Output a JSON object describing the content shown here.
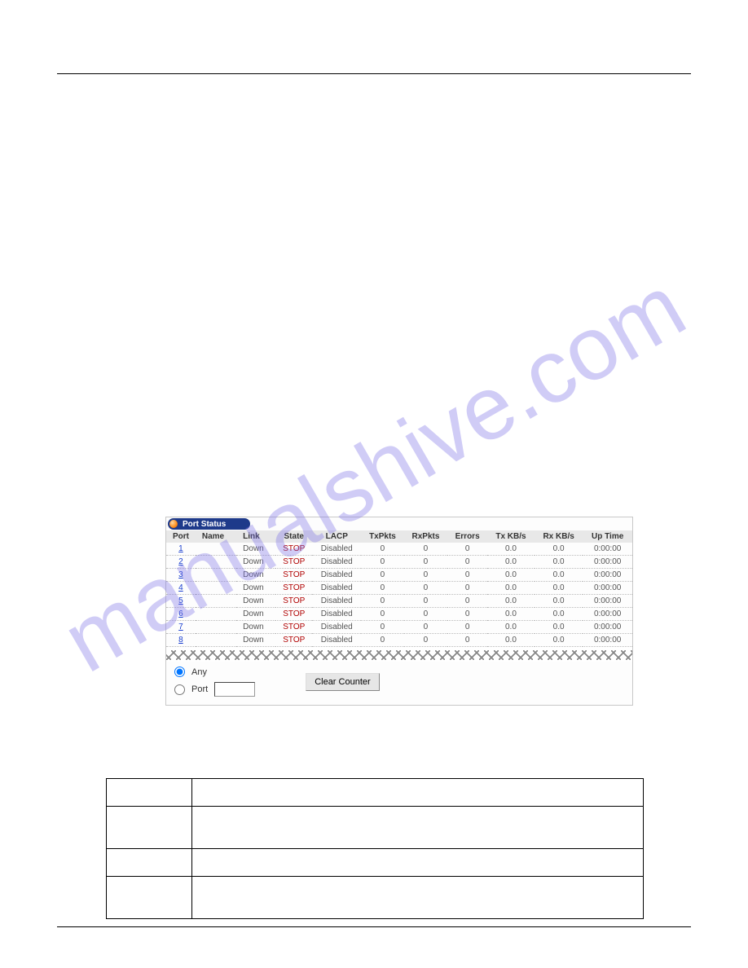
{
  "watermark": "manualshive.com",
  "panel": {
    "title": "Port Status",
    "headers": [
      "Port",
      "Name",
      "Link",
      "State",
      "LACP",
      "TxPkts",
      "RxPkts",
      "Errors",
      "Tx KB/s",
      "Rx KB/s",
      "Up Time"
    ],
    "rows": [
      {
        "port": "1",
        "name": "",
        "link": "Down",
        "state": "STOP",
        "lacp": "Disabled",
        "tx": "0",
        "rx": "0",
        "err": "0",
        "txkb": "0.0",
        "rxkb": "0.0",
        "up": "0:00:00"
      },
      {
        "port": "2",
        "name": "",
        "link": "Down",
        "state": "STOP",
        "lacp": "Disabled",
        "tx": "0",
        "rx": "0",
        "err": "0",
        "txkb": "0.0",
        "rxkb": "0.0",
        "up": "0:00:00"
      },
      {
        "port": "3",
        "name": "",
        "link": "Down",
        "state": "STOP",
        "lacp": "Disabled",
        "tx": "0",
        "rx": "0",
        "err": "0",
        "txkb": "0.0",
        "rxkb": "0.0",
        "up": "0:00:00"
      },
      {
        "port": "4",
        "name": "",
        "link": "Down",
        "state": "STOP",
        "lacp": "Disabled",
        "tx": "0",
        "rx": "0",
        "err": "0",
        "txkb": "0.0",
        "rxkb": "0.0",
        "up": "0:00:00"
      },
      {
        "port": "5",
        "name": "",
        "link": "Down",
        "state": "STOP",
        "lacp": "Disabled",
        "tx": "0",
        "rx": "0",
        "err": "0",
        "txkb": "0.0",
        "rxkb": "0.0",
        "up": "0:00:00"
      },
      {
        "port": "6",
        "name": "",
        "link": "Down",
        "state": "STOP",
        "lacp": "Disabled",
        "tx": "0",
        "rx": "0",
        "err": "0",
        "txkb": "0.0",
        "rxkb": "0.0",
        "up": "0:00:00"
      },
      {
        "port": "7",
        "name": "",
        "link": "Down",
        "state": "STOP",
        "lacp": "Disabled",
        "tx": "0",
        "rx": "0",
        "err": "0",
        "txkb": "0.0",
        "rxkb": "0.0",
        "up": "0:00:00"
      },
      {
        "port": "8",
        "name": "",
        "link": "Down",
        "state": "STOP",
        "lacp": "Disabled",
        "tx": "0",
        "rx": "0",
        "err": "0",
        "txkb": "0.0",
        "rxkb": "0.0",
        "up": "0:00:00"
      }
    ],
    "controls": {
      "any_label": "Any",
      "port_label": "Port",
      "port_value": "",
      "clear_label": "Clear Counter"
    }
  }
}
